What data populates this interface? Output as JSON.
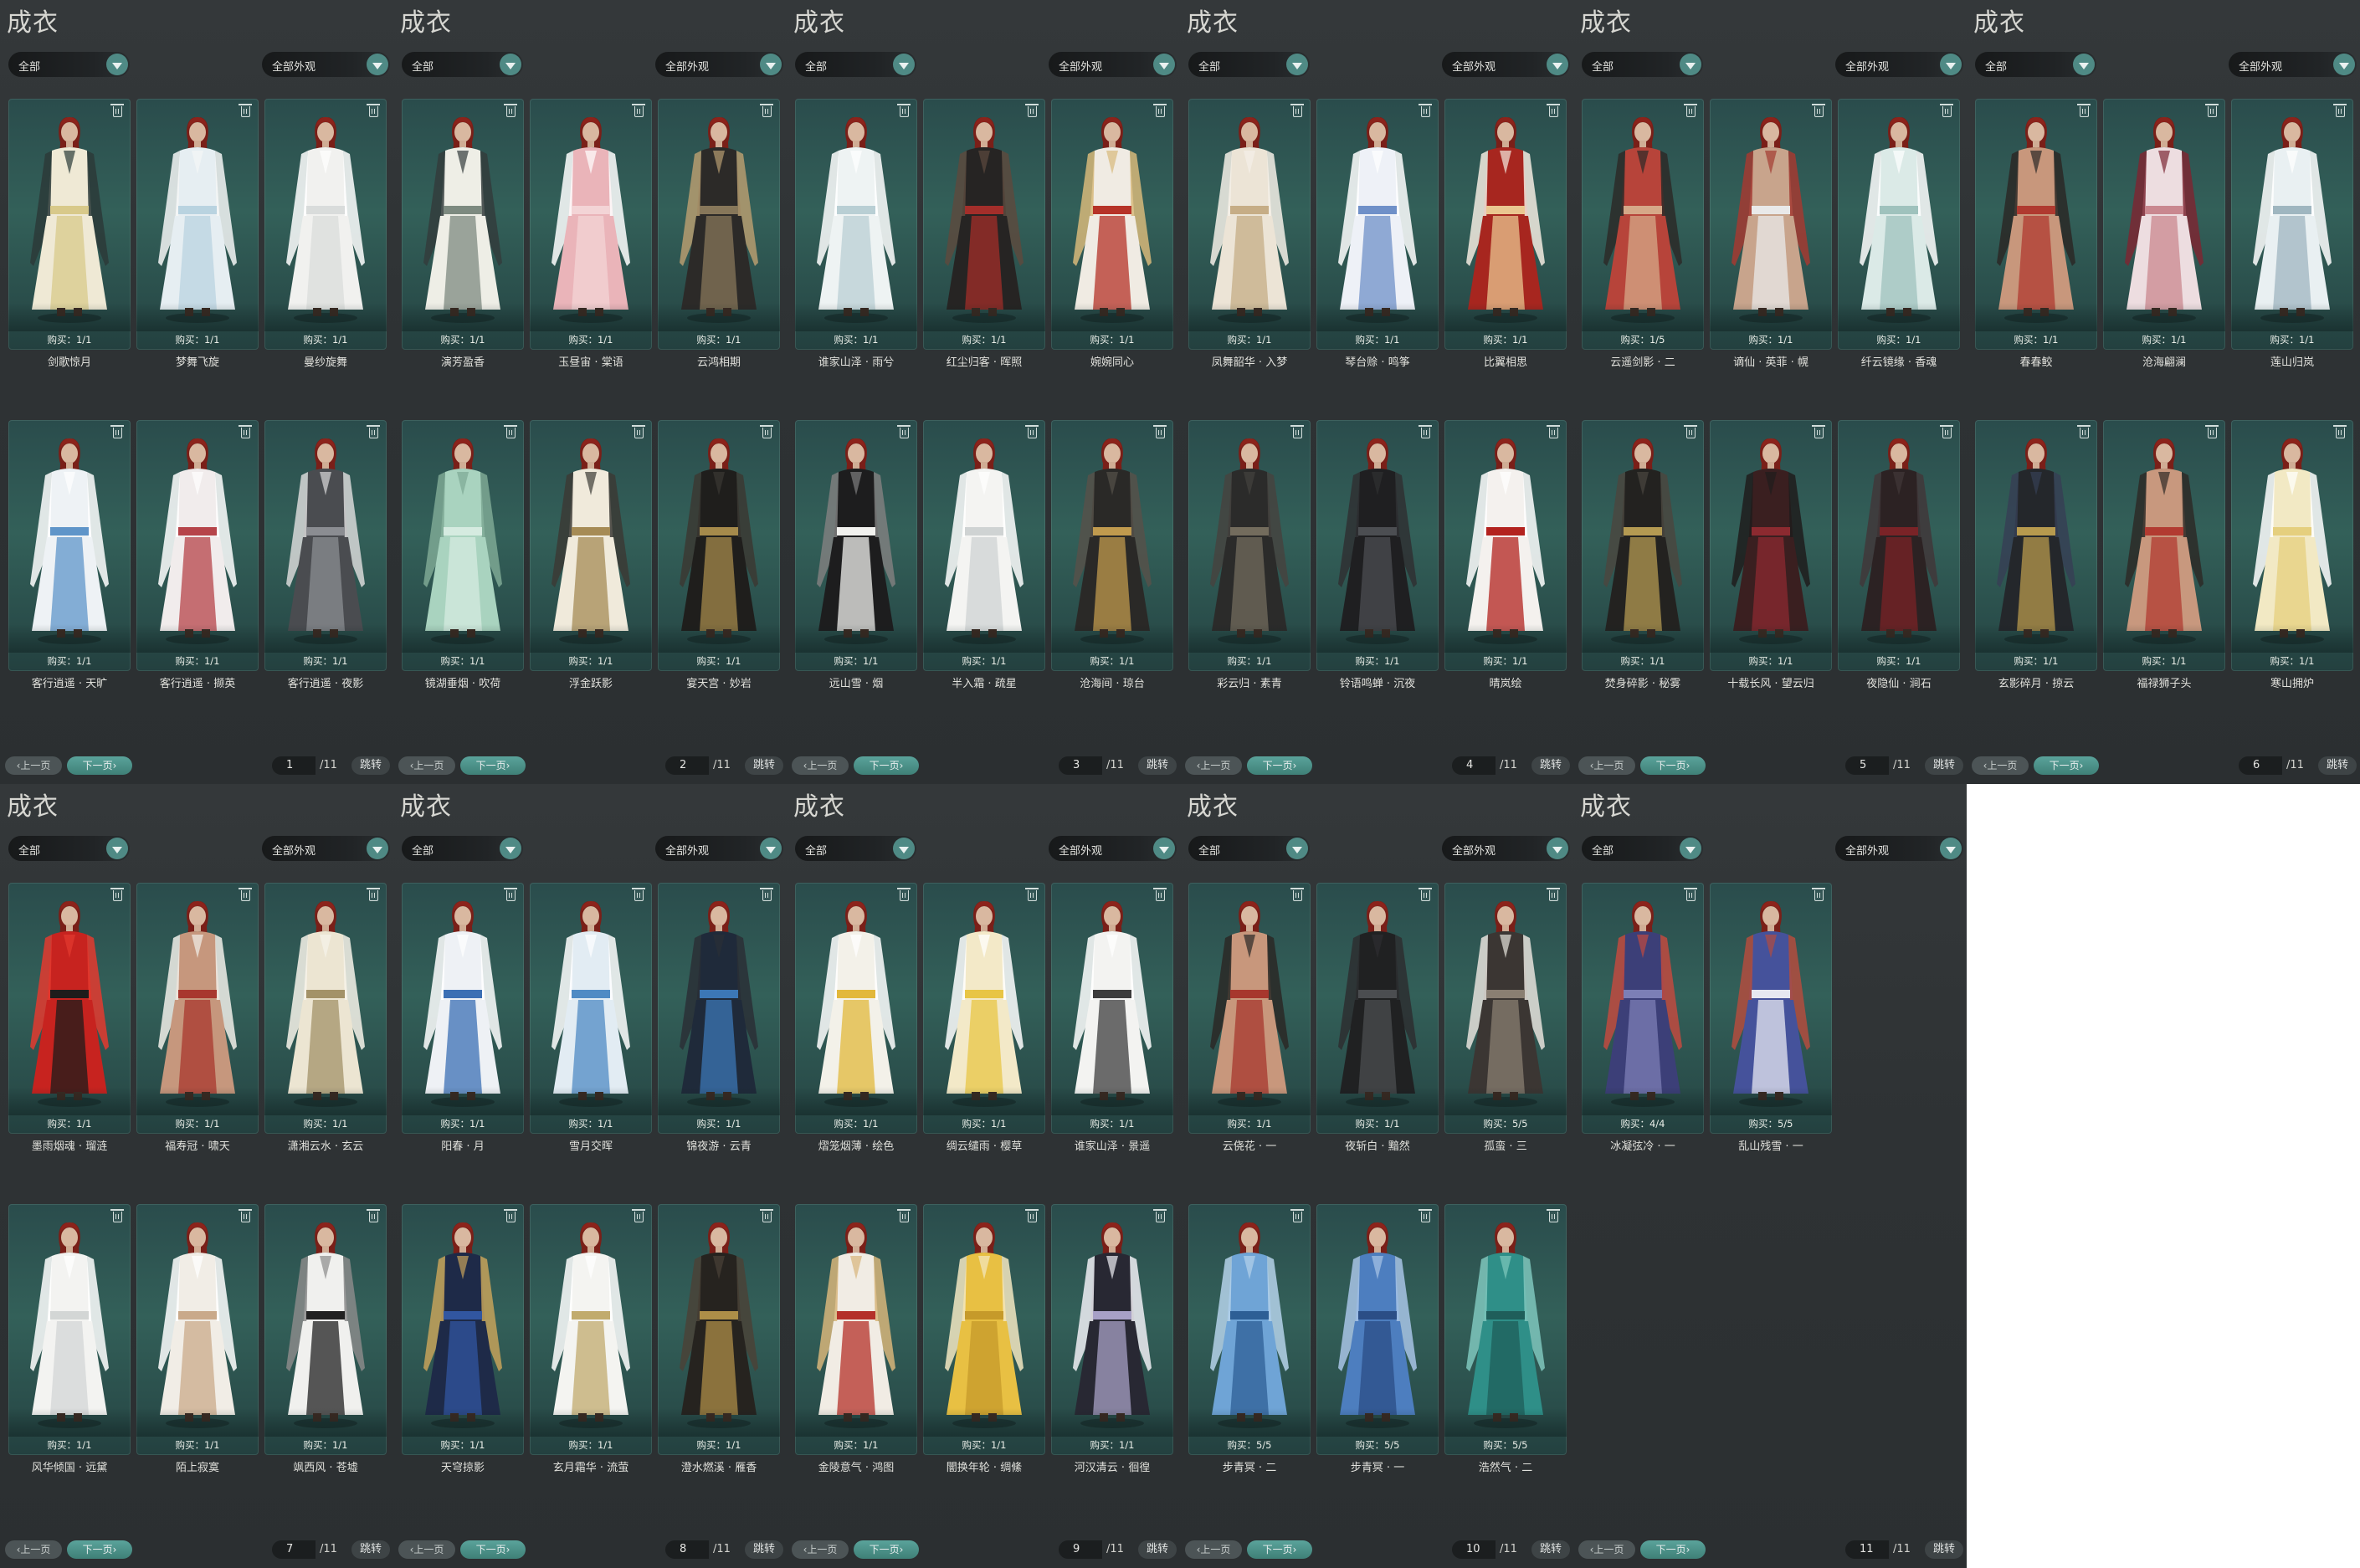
{
  "panel_title": "成衣",
  "filter_category": "全部",
  "filter_look": "全部外观",
  "prev_label": "上一页",
  "next_label": "下一页",
  "jump_label": "跳转",
  "total_pages": "/11",
  "colors": {
    "panel_bg": "#2e3234",
    "card_bg": "#2f5955",
    "accent": "#4f8a85",
    "text": "#e1e1dc"
  },
  "icons": {
    "delete": "trash-icon",
    "dropdown": "chevron-down-icon"
  },
  "pages": [
    {
      "page": "1",
      "items": [
        {
          "name": "剑歌惊月",
          "buy": "购买：1/1",
          "palette": [
            "#efe9d5",
            "#d8c98a",
            "#2b3a38"
          ]
        },
        {
          "name": "梦舞飞旋",
          "buy": "购买：1/1",
          "palette": [
            "#e6eef2",
            "#b9d3e0",
            "#f4f6f6"
          ]
        },
        {
          "name": "曼纱旋舞",
          "buy": "购买：1/1",
          "palette": [
            "#f1f1ef",
            "#d9dcdb",
            "#ffffff"
          ]
        },
        {
          "name": "客行逍遥 · 天旷",
          "buy": "购买：1/1",
          "palette": [
            "#eef2f5",
            "#5f95c9",
            "#ffffff"
          ]
        },
        {
          "name": "客行逍遥 · 撷英",
          "buy": "购买：1/1",
          "palette": [
            "#f1ecec",
            "#b6444a",
            "#ffffff"
          ]
        },
        {
          "name": "客行逍遥 · 夜影",
          "buy": "购买：1/1",
          "palette": [
            "#4a4c50",
            "#8b8d92",
            "#d8d8d8"
          ]
        }
      ]
    },
    {
      "page": "2",
      "items": [
        {
          "name": "演芳盈香",
          "buy": "购买：1/1",
          "palette": [
            "#eeeee6",
            "#7d8a80",
            "#333c3c"
          ]
        },
        {
          "name": "玉昼宙 · 棠语",
          "buy": "购买：1/1",
          "palette": [
            "#eab4b9",
            "#f3d4d6",
            "#ffffff"
          ]
        },
        {
          "name": "云鸿相期",
          "buy": "购买：1/1",
          "palette": [
            "#2c2a28",
            "#87775a",
            "#b69c70"
          ]
        },
        {
          "name": "镜湖垂烟 · 吹荷",
          "buy": "购买：1/1",
          "palette": [
            "#a9d3bf",
            "#d5ebe0",
            "#7ea894"
          ]
        },
        {
          "name": "浮金跃影",
          "buy": "购买：1/1",
          "palette": [
            "#f0eadb",
            "#a68b55",
            "#3b3a35"
          ]
        },
        {
          "name": "宴天宫 · 妙岩",
          "buy": "购买：1/1",
          "palette": [
            "#1f1e1c",
            "#a58a4b",
            "#3b3833"
          ]
        }
      ]
    },
    {
      "page": "3",
      "items": [
        {
          "name": "谁家山泽 · 雨兮",
          "buy": "购买：1/1",
          "palette": [
            "#eef3f3",
            "#b9cfd4",
            "#ffffff"
          ]
        },
        {
          "name": "红尘归客 · 晖照",
          "buy": "购买：1/1",
          "palette": [
            "#262423",
            "#a32e2a",
            "#5c4a3e"
          ]
        },
        {
          "name": "婉婉同心",
          "buy": "购买：1/1",
          "palette": [
            "#f0ebe3",
            "#b63328",
            "#d7b97a"
          ]
        },
        {
          "name": "远山雪 · 烟",
          "buy": "购买：1/1",
          "palette": [
            "#1d1d1e",
            "#f2f2ef",
            "#7f7f7f"
          ]
        },
        {
          "name": "半入霜 · 疏星",
          "buy": "购买：1/1",
          "palette": [
            "#f4f4f2",
            "#cfd3d3",
            "#ffffff"
          ]
        },
        {
          "name": "沧海间 · 琼台",
          "buy": "购买：1/1",
          "palette": [
            "#2a2927",
            "#c09a4e",
            "#56514a"
          ]
        }
      ]
    },
    {
      "page": "4",
      "items": [
        {
          "name": "凤舞韶华 · 入梦",
          "buy": "购买：1/1",
          "palette": [
            "#ece4d6",
            "#c6ad86",
            "#f5f0e8"
          ]
        },
        {
          "name": "琴台赊 · 鸣筝",
          "buy": "购买：1/1",
          "palette": [
            "#eef1f7",
            "#6f90c8",
            "#ffffff"
          ]
        },
        {
          "name": "比翼相思",
          "buy": "购买：1/1",
          "palette": [
            "#a7261f",
            "#eac690",
            "#f3ebe0"
          ]
        },
        {
          "name": "彩云归 · 素青",
          "buy": "购买：1/1",
          "palette": [
            "#2b2b2a",
            "#736c5d",
            "#45433f"
          ]
        },
        {
          "name": "铃语鸣蝉 · 沉夜",
          "buy": "购买：1/1",
          "palette": [
            "#1f1f21",
            "#4c4e52",
            "#2f3032"
          ]
        },
        {
          "name": "晴岚绘",
          "buy": "购买：1/1",
          "palette": [
            "#f4f1ee",
            "#b3231f",
            "#ffffff"
          ]
        }
      ]
    },
    {
      "page": "5",
      "items": [
        {
          "name": "云遥剑影 · 二",
          "buy": "购买：1/5",
          "palette": [
            "#b7443a",
            "#d6a888",
            "#2b2a28"
          ]
        },
        {
          "name": "谪仙 · 英菲 · 幌",
          "buy": "购买：1/1",
          "palette": [
            "#c8a48c",
            "#e9e9e9",
            "#a33a31"
          ]
        },
        {
          "name": "纤云镜缘 · 香魂",
          "buy": "购买：1/1",
          "palette": [
            "#dbeae7",
            "#9fc2bd",
            "#ffffff"
          ]
        },
        {
          "name": "焚身碎影 · 秘雾",
          "buy": "购买：1/1",
          "palette": [
            "#232220",
            "#b49a52",
            "#4a4640"
          ]
        },
        {
          "name": "十载长风 · 望云归",
          "buy": "购买：1/1",
          "palette": [
            "#3a1f20",
            "#8c2a30",
            "#1f1c1c"
          ]
        },
        {
          "name": "夜隐仙 · 涧石",
          "buy": "购买：1/1",
          "palette": [
            "#2c2223",
            "#7a2327",
            "#413739"
          ]
        }
      ]
    },
    {
      "page": "6",
      "items": [
        {
          "name": "春春鲛",
          "buy": "购买：1/1",
          "palette": [
            "#c8977c",
            "#b03a30",
            "#2a2826"
          ]
        },
        {
          "name": "沧海翩澜",
          "buy": "购买：1/1",
          "palette": [
            "#eddde0",
            "#c9878f",
            "#7b2733"
          ]
        },
        {
          "name": "莲山归岚",
          "buy": "购买：1/1",
          "palette": [
            "#e9f0f2",
            "#9fb6c0",
            "#ffffff"
          ]
        },
        {
          "name": "玄影碎月 · 掠云",
          "buy": "购买：1/1",
          "palette": [
            "#24272b",
            "#b79a4e",
            "#364055"
          ]
        },
        {
          "name": "福禄狮子头",
          "buy": "购买：1/1",
          "palette": [
            "#c8987e",
            "#b23b31",
            "#2d2a27"
          ]
        },
        {
          "name": "寒山拥炉",
          "buy": "购买：1/1",
          "palette": [
            "#f2e9c4",
            "#e5cf7e",
            "#ffffff"
          ]
        }
      ]
    },
    {
      "page": "7",
      "items": [
        {
          "name": "墨雨烟魂 · 瑠涟",
          "buy": "购买：1/1",
          "palette": [
            "#c7231f",
            "#1e1c1b",
            "#e43a2f"
          ]
        },
        {
          "name": "福寿冠 · 啸天",
          "buy": "购买：1/1",
          "palette": [
            "#c6977d",
            "#a8372e",
            "#f1efe9"
          ]
        },
        {
          "name": "潇湘云水 · 玄云",
          "buy": "购买：1/1",
          "palette": [
            "#ece5d2",
            "#a39268",
            "#f7f3ea"
          ]
        },
        {
          "name": "风华倾国 · 远黛",
          "buy": "购买：1/1",
          "palette": [
            "#f3f3f1",
            "#d3d6d5",
            "#ffffff"
          ]
        },
        {
          "name": "陌上寂寞",
          "buy": "购买：1/1",
          "palette": [
            "#f1ede6",
            "#c9a98a",
            "#ffffff"
          ]
        },
        {
          "name": "飒西风 · 苍墟",
          "buy": "购买：1/1",
          "palette": [
            "#f0f0ee",
            "#222222",
            "#8a8a8a"
          ]
        }
      ]
    },
    {
      "page": "8",
      "items": [
        {
          "name": "阳春 · 月",
          "buy": "购买：1/1",
          "palette": [
            "#eef1f5",
            "#3b6fb4",
            "#ffffff"
          ]
        },
        {
          "name": "雪月交晖",
          "buy": "购买：1/1",
          "palette": [
            "#e2ecf3",
            "#4f8bc4",
            "#ffffff"
          ]
        },
        {
          "name": "锦夜游 · 云青",
          "buy": "购买：1/1",
          "palette": [
            "#1f2a3a",
            "#3c77b6",
            "#2a2f36"
          ]
        },
        {
          "name": "天穹掠影",
          "buy": "购买：1/1",
          "palette": [
            "#1e2a48",
            "#3156a0",
            "#c6a25b"
          ]
        },
        {
          "name": "玄月霜华 · 流萤",
          "buy": "购买：1/1",
          "palette": [
            "#f4f4f1",
            "#c1ab6d",
            "#ffffff"
          ]
        },
        {
          "name": "澄水燃溪 · 雁香",
          "buy": "购买：1/1",
          "palette": [
            "#26231f",
            "#ad8e48",
            "#4a4237"
          ]
        }
      ]
    },
    {
      "page": "9",
      "items": [
        {
          "name": "熠笼烟薄 · 绘色",
          "buy": "购买：1/1",
          "palette": [
            "#f3f1e9",
            "#e2b83b",
            "#ffffff"
          ]
        },
        {
          "name": "绸云缱雨 · 樱草",
          "buy": "购买：1/1",
          "palette": [
            "#f3e9c8",
            "#e8c545",
            "#ffffff"
          ]
        },
        {
          "name": "谁家山泽 · 景遥",
          "buy": "购买：1/1",
          "palette": [
            "#f3f3f1",
            "#3d3d3d",
            "#ffffff"
          ]
        },
        {
          "name": "金陵意气 · 鸿图",
          "buy": "购买：1/1",
          "palette": [
            "#f1ece4",
            "#b4312a",
            "#d7b57a"
          ]
        },
        {
          "name": "闇换年轮 · 绸絛",
          "buy": "购买：1/1",
          "palette": [
            "#e8c043",
            "#c69a2a",
            "#f3e8c2"
          ]
        },
        {
          "name": "河汉清云 · 徊徨",
          "buy": "购买：1/1",
          "palette": [
            "#282833",
            "#a7a0c6",
            "#f0eff5"
          ]
        }
      ]
    },
    {
      "page": "10",
      "items": [
        {
          "name": "云侥花 · 一",
          "buy": "购买：1/1",
          "palette": [
            "#c8977c",
            "#a7372d",
            "#2a2826"
          ]
        },
        {
          "name": "夜斩白 · 黯然",
          "buy": "购买：1/1",
          "palette": [
            "#202122",
            "#4b4d50",
            "#2d2e30"
          ]
        },
        {
          "name": "孤蛮 · 三",
          "buy": "购买：5/5",
          "palette": [
            "#3b3633",
            "#8a7f72",
            "#e6e2dc"
          ]
        },
        {
          "name": "步青冥 · 二",
          "buy": "购买：5/5",
          "palette": [
            "#6fa4d6",
            "#2d5f95",
            "#b5d2ea"
          ]
        },
        {
          "name": "步青冥 · 一",
          "buy": "购买：5/5",
          "palette": [
            "#4d7ebf",
            "#2b4e86",
            "#a8c4e6"
          ]
        },
        {
          "name": "浩然气 · 二",
          "buy": "购买：5/5",
          "palette": [
            "#2f8f88",
            "#1f5e5a",
            "#7fc7bd"
          ]
        }
      ]
    },
    {
      "page": "11",
      "items": [
        {
          "name": "冰凝弦冷 · 一",
          "buy": "购买：4/4",
          "palette": [
            "#3c3f78",
            "#7c7fb6",
            "#c14a3f"
          ]
        },
        {
          "name": "乱山残雪 · 一",
          "buy": "购买：5/5",
          "palette": [
            "#45529b",
            "#e7e8f1",
            "#b34c3e"
          ]
        }
      ]
    }
  ]
}
